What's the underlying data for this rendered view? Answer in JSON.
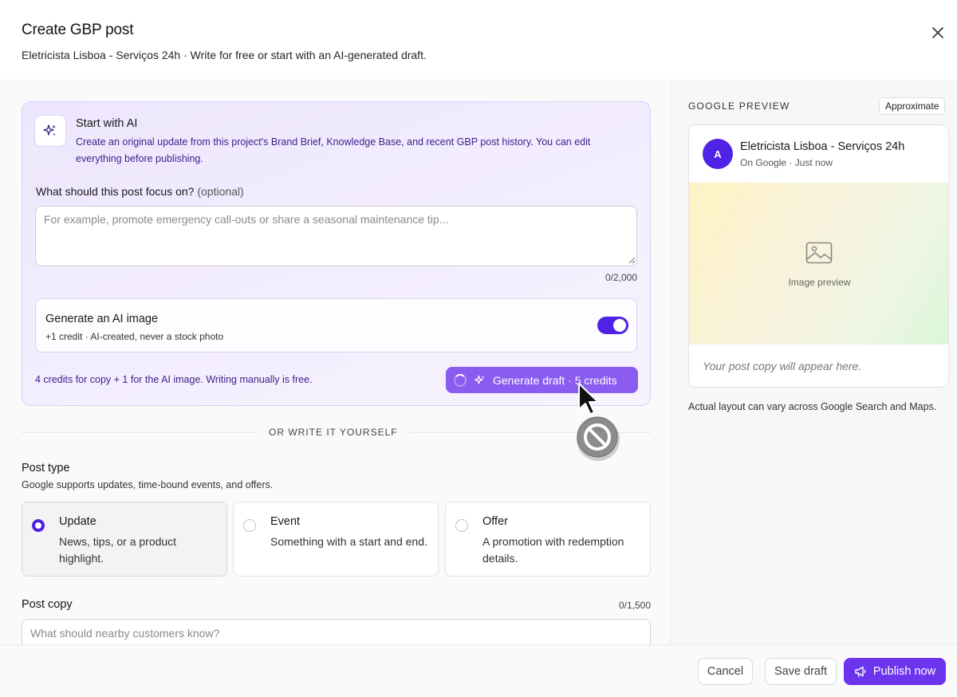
{
  "header": {
    "title": "Create GBP post",
    "subtitle": "Eletricista Lisboa - Serviços 24h · Write for free or start with an AI-generated draft."
  },
  "ai_section": {
    "title": "Start with AI",
    "description": "Create an original update from this project's Brand Brief, Knowledge Base, and recent GBP post history. You can edit everything before publishing.",
    "focus_label": "What should this post focus on?",
    "focus_optional": "(optional)",
    "focus_placeholder": "For example, promote emergency call-outs or share a seasonal maintenance tip...",
    "focus_value": "",
    "focus_counter": "0/2,000",
    "image_toggle": {
      "title": "Generate an AI image",
      "subtitle": "+1 credit · AI-created, never a stock photo",
      "enabled": true
    },
    "credit_note": "4 credits for copy + 1 for the AI image. Writing manually is free.",
    "generate_label": "Generate draft · 5 credits"
  },
  "divider_text": "OR WRITE IT YOURSELF",
  "post_type": {
    "label": "Post type",
    "subtitle": "Google supports updates, time-bound events, and offers.",
    "options": [
      {
        "name": "Update",
        "desc": "News, tips, or a product highlight.",
        "selected": true
      },
      {
        "name": "Event",
        "desc": "Something with a start and end.",
        "selected": false
      },
      {
        "name": "Offer",
        "desc": "A promotion with redemption details.",
        "selected": false
      }
    ]
  },
  "post_copy": {
    "label": "Post copy",
    "counter": "0/1,500",
    "placeholder": "What should nearby customers know?",
    "value": ""
  },
  "preview": {
    "label": "GOOGLE PREVIEW",
    "badge": "Approximate",
    "avatar_letter": "A",
    "business_name": "Eletricista Lisboa - Serviços 24h",
    "meta": "On Google · Just now",
    "image_caption": "Image preview",
    "copy_placeholder": "Your post copy will appear here.",
    "note": "Actual layout can vary across Google Search and Maps."
  },
  "footer": {
    "cancel": "Cancel",
    "save_draft": "Save draft",
    "publish": "Publish now"
  },
  "colors": {
    "accent": "#4f22e6",
    "generate_button": "#8a5cf0",
    "publish_button": "#6d34ee",
    "ai_card_bg": "#ede6fd"
  },
  "icons": {
    "close": "close-icon",
    "ai": "sparkle-icon",
    "image": "image-icon",
    "publish": "megaphone-icon",
    "cursor": "not-allowed-cursor-icon"
  }
}
